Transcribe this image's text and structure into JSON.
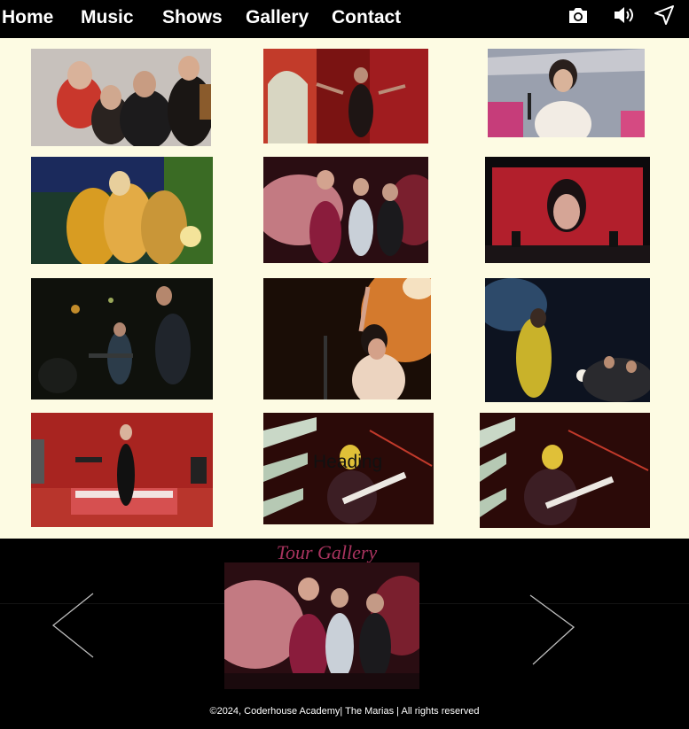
{
  "nav": {
    "links": [
      {
        "label": "Home"
      },
      {
        "label": "Music"
      },
      {
        "label": "Shows"
      },
      {
        "label": "Gallery"
      },
      {
        "label": "Contact"
      }
    ],
    "icons": [
      "camera-icon",
      "speaker-icon",
      "send-icon"
    ]
  },
  "gallery": {
    "overlay_heading": "Heading"
  },
  "carousel": {
    "title": "Tour Gallery",
    "prev_icon": "chevron-left-icon",
    "next_icon": "chevron-right-icon"
  },
  "footer": {
    "text": "©2024, Coderhouse Academy| The Marias | All rights reserved"
  },
  "colors": {
    "nav_bg": "#000000",
    "page_bg": "#fdfbe3",
    "carousel_bg": "#000000",
    "title_accent": "#a8335e"
  }
}
